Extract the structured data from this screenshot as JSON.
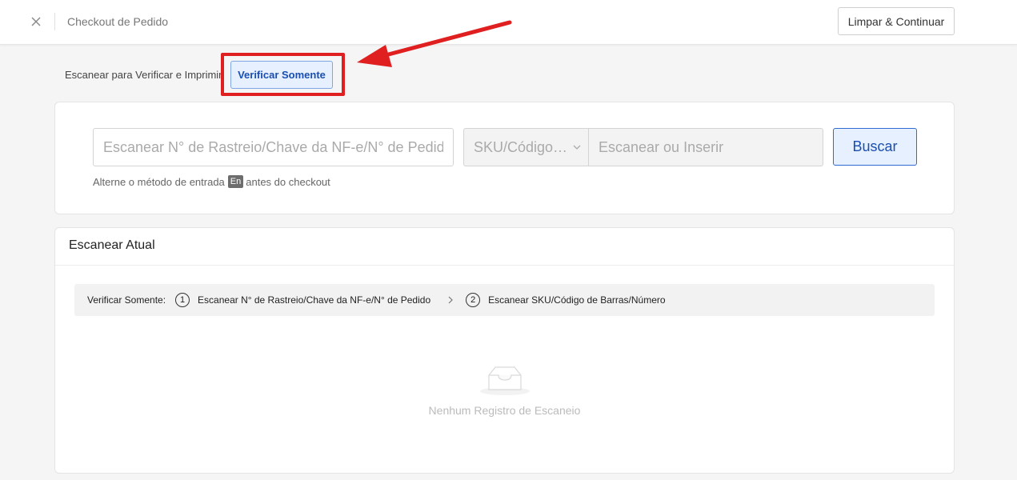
{
  "header": {
    "title": "Checkout de Pedido",
    "clear_button": "Limpar & Continuar"
  },
  "mode": {
    "label": "Escanear para Verificar e Imprimir",
    "selected_button": "Verificar Somente"
  },
  "search": {
    "main_placeholder": "Escanear N° de Rastreio/Chave da NF-e/N° de Pedido",
    "sku_select_value": "SKU/Código…",
    "sku_placeholder": "Escanear ou Inserir",
    "search_button": "Buscar",
    "hint_before": "Alterne o método de entrada",
    "hint_key": "En",
    "hint_after": "antes do checkout"
  },
  "scan": {
    "title": "Escanear Atual",
    "steps_label": "Verificar Somente:",
    "steps": [
      {
        "num": "1",
        "label": "Escanear N° de Rastreio/Chave da NF-e/N° de Pedido"
      },
      {
        "num": "2",
        "label": "Escanear SKU/Código de Barras/Número"
      }
    ],
    "empty_text": "Nenhum Registro de Escaneio"
  },
  "colors": {
    "accent": "#2f6bd0",
    "highlight": "#e02020"
  },
  "icons": {
    "close": "close-icon",
    "chevron": "chevron-down-icon",
    "step_separator": "chevron-right-icon",
    "empty": "inbox-icon"
  }
}
